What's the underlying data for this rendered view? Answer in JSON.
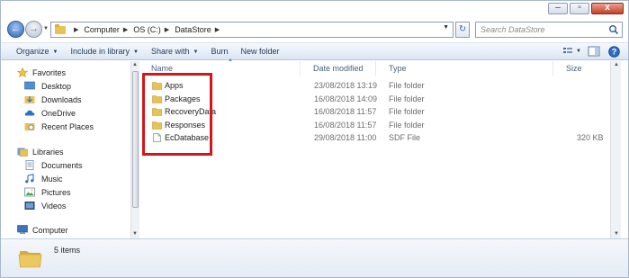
{
  "window": {
    "controls": {
      "minimize": "minimize-icon",
      "maximize": "maximize-icon",
      "close": "close-icon"
    }
  },
  "address": {
    "breadcrumbs": [
      "Computer",
      "OS (C:)",
      "DataStore"
    ],
    "search_placeholder": "Search DataStore"
  },
  "toolbar": {
    "organize": "Organize",
    "include_in_library": "Include in library",
    "share_with": "Share with",
    "burn": "Burn",
    "new_folder": "New folder"
  },
  "nav": {
    "favorites_label": "Favorites",
    "favorites": [
      "Desktop",
      "Downloads",
      "OneDrive",
      "Recent Places"
    ],
    "libraries_label": "Libraries",
    "libraries": [
      "Documents",
      "Music",
      "Pictures",
      "Videos"
    ],
    "computer_label": "Computer"
  },
  "columns": {
    "name": "Name",
    "date": "Date modified",
    "type": "Type",
    "size": "Size"
  },
  "files": [
    {
      "name": "Apps",
      "date": "23/08/2018 13:19",
      "type": "File folder",
      "size": "",
      "icon": "folder-icon"
    },
    {
      "name": "Packages",
      "date": "16/08/2018 14:09",
      "type": "File folder",
      "size": "",
      "icon": "folder-icon"
    },
    {
      "name": "RecoveryData",
      "date": "16/08/2018 11:57",
      "type": "File folder",
      "size": "",
      "icon": "folder-icon"
    },
    {
      "name": "Responses",
      "date": "16/08/2018 11:57",
      "type": "File folder",
      "size": "",
      "icon": "folder-icon"
    },
    {
      "name": "EcDatabase",
      "date": "29/08/2018 11:00",
      "type": "SDF File",
      "size": "320 KB",
      "icon": "file-icon"
    }
  ],
  "status": {
    "item_count": "5 items"
  },
  "colors": {
    "highlight_border": "#d4161c",
    "folder": "#e7c257"
  }
}
